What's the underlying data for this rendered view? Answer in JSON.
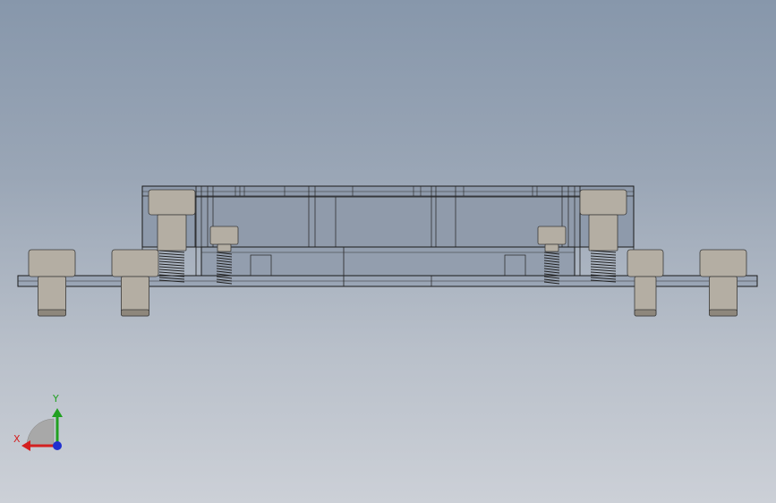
{
  "viewport": {
    "background_top": "#8797ab",
    "background_bottom": "#ccd0d7"
  },
  "model": {
    "icon": "cad-assembly-front-view",
    "line_color": "#1a1a1a",
    "housing_fill": "#8e9aab",
    "screw_fill": "#b4aea3",
    "screw_shadow": "#8e877c"
  },
  "triad": {
    "x_label": "X",
    "y_label": "Y",
    "x_color": "#d42020",
    "y_color": "#20a020",
    "z_color": "#2030d0"
  }
}
